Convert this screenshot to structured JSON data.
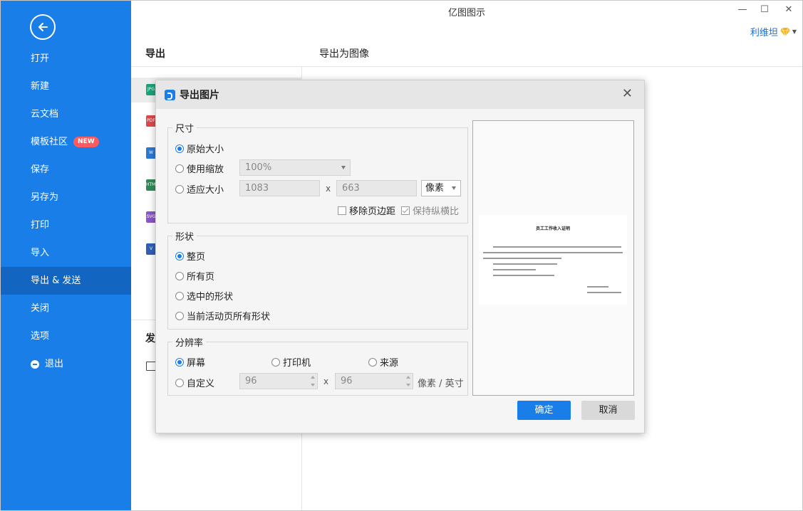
{
  "window": {
    "title": "亿图图示",
    "minimize": "—",
    "maximize": "☐",
    "close": "✕"
  },
  "user": {
    "name": "利维坦"
  },
  "sidebar": {
    "items": [
      {
        "label": "打开"
      },
      {
        "label": "新建"
      },
      {
        "label": "云文档"
      },
      {
        "label": "模板社区",
        "badge": "NEW"
      },
      {
        "label": "保存"
      },
      {
        "label": "另存为"
      },
      {
        "label": "打印"
      },
      {
        "label": "导入"
      },
      {
        "label": "导出 & 发送",
        "active": true
      },
      {
        "label": "关闭"
      },
      {
        "label": "选项"
      },
      {
        "label": "退出"
      }
    ]
  },
  "export_panel": {
    "title": "导出",
    "right_title": "导出为图像",
    "formats": [
      {
        "label": "JPG",
        "color": "#1aa37a"
      },
      {
        "label": "PDF",
        "color": "#e0474c"
      },
      {
        "label": "W",
        "color": "#2b79d6"
      },
      {
        "label": "HTML",
        "color": "#2e8b57"
      },
      {
        "label": "SVG",
        "color": "#8a56c8"
      },
      {
        "label": "V",
        "color": "#2f5fb8"
      }
    ],
    "send_title": "发"
  },
  "dialog": {
    "title": "导出图片",
    "close": "✕",
    "size": {
      "legend": "尺寸",
      "opt_original": "原始大小",
      "opt_scale": "使用缩放",
      "scale_value": "100%",
      "opt_fit": "适应大小",
      "fit_width": "1083",
      "fit_height": "663",
      "x": "x",
      "unit": "像素",
      "remove_margin": "移除页边距",
      "keep_ratio": "保持纵横比"
    },
    "shape": {
      "legend": "形状",
      "opt_whole": "整页",
      "opt_all": "所有页",
      "opt_selected": "选中的形状",
      "opt_active_all": "当前活动页所有形状"
    },
    "resolution": {
      "legend": "分辨率",
      "opt_screen": "屏幕",
      "opt_printer": "打印机",
      "opt_source": "来源",
      "opt_custom": "自定义",
      "dpi_x": "96",
      "dpi_y": "96",
      "x": "x",
      "unit": "像素 / 英寸"
    },
    "preview": {
      "doc_title": "员工工作收入证明"
    },
    "ok": "确定",
    "cancel": "取消"
  }
}
